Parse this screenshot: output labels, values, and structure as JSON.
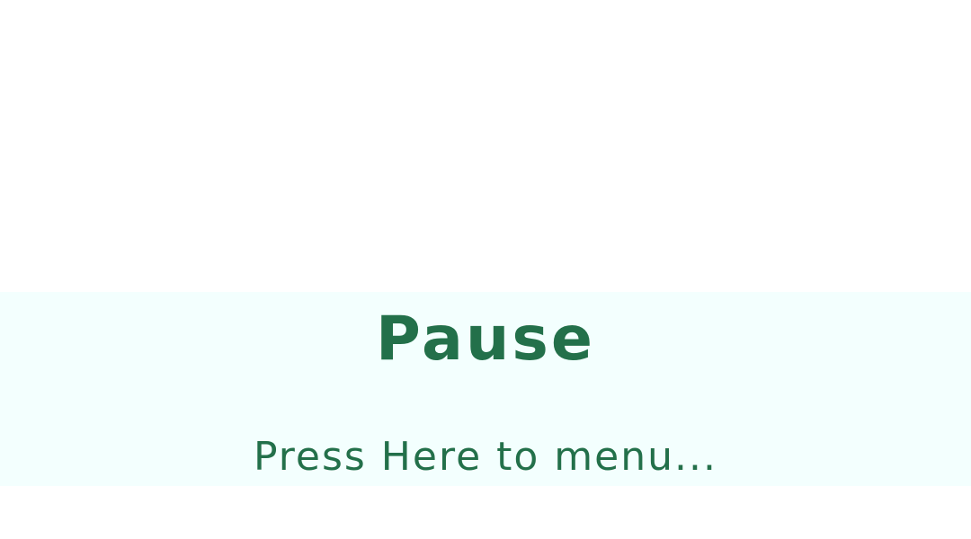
{
  "pause_overlay": {
    "title": "Pause",
    "menu_link_label": "Press Here to menu..."
  },
  "colors": {
    "background": "#ffffff",
    "band": "#f3fffe",
    "text": "#23704a"
  }
}
